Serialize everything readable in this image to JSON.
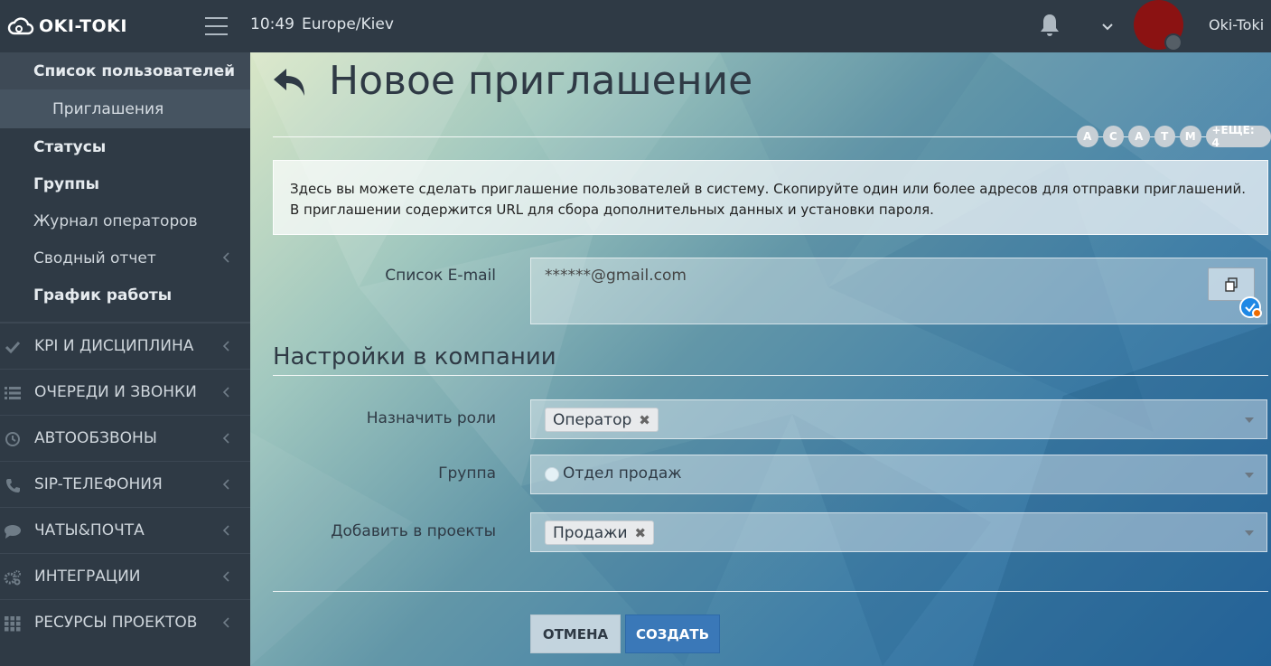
{
  "topbar": {
    "logo_text": "OKI-TOKI",
    "time": "10:49",
    "timezone": "Europe/Kiev",
    "username": "Oki-Toki",
    "avatar_color": "#8b1212"
  },
  "sidebar": {
    "items": [
      {
        "label": "Список пользователей"
      },
      {
        "label": "Приглашения"
      },
      {
        "label": "Статусы"
      },
      {
        "label": "Группы"
      },
      {
        "label": "Журнал операторов"
      },
      {
        "label": "Сводный отчет"
      },
      {
        "label": "График работы"
      }
    ],
    "sections": [
      {
        "label": "KPI И ДИСЦИПЛИНА",
        "icon": "check-icon"
      },
      {
        "label": "ОЧЕРЕДИ И ЗВОНКИ",
        "icon": "list-icon"
      },
      {
        "label": "АВТООБЗВОНЫ",
        "icon": "clock-icon"
      },
      {
        "label": "SIP-ТЕЛЕФОНИЯ",
        "icon": "phone-icon"
      },
      {
        "label": "ЧАТЫ&ПОЧТА",
        "icon": "chat-icon"
      },
      {
        "label": "ИНТЕГРАЦИИ",
        "icon": "gears-icon"
      },
      {
        "label": "РЕСУРСЫ ПРОЕКТОВ",
        "icon": "grid-icon"
      }
    ]
  },
  "main": {
    "title": "Новое приглашение",
    "online_users": [
      "A",
      "C",
      "A",
      "T",
      "M"
    ],
    "online_more": "+ЕЩЕ: 4",
    "info_text": "Здесь вы можете сделать приглашение пользователей в систему. Скопируйте один или более адресов для отправки приглашений. В приглашении содержится URL для сбора дополнительных данных и установки пароля.",
    "email_label": "Список E-mail",
    "email_value": "******@gmail.com",
    "section_title": "Настройки в компании",
    "roles_label": "Назначить роли",
    "roles_tag": "Оператор",
    "group_label": "Группа",
    "group_value": "Отдел продаж",
    "projects_label": "Добавить в проекты",
    "projects_tag": "Продажи",
    "cancel_label": "ОТМЕНА",
    "create_label": "СОЗДАТЬ",
    "accent_color": "#3a78b8"
  }
}
